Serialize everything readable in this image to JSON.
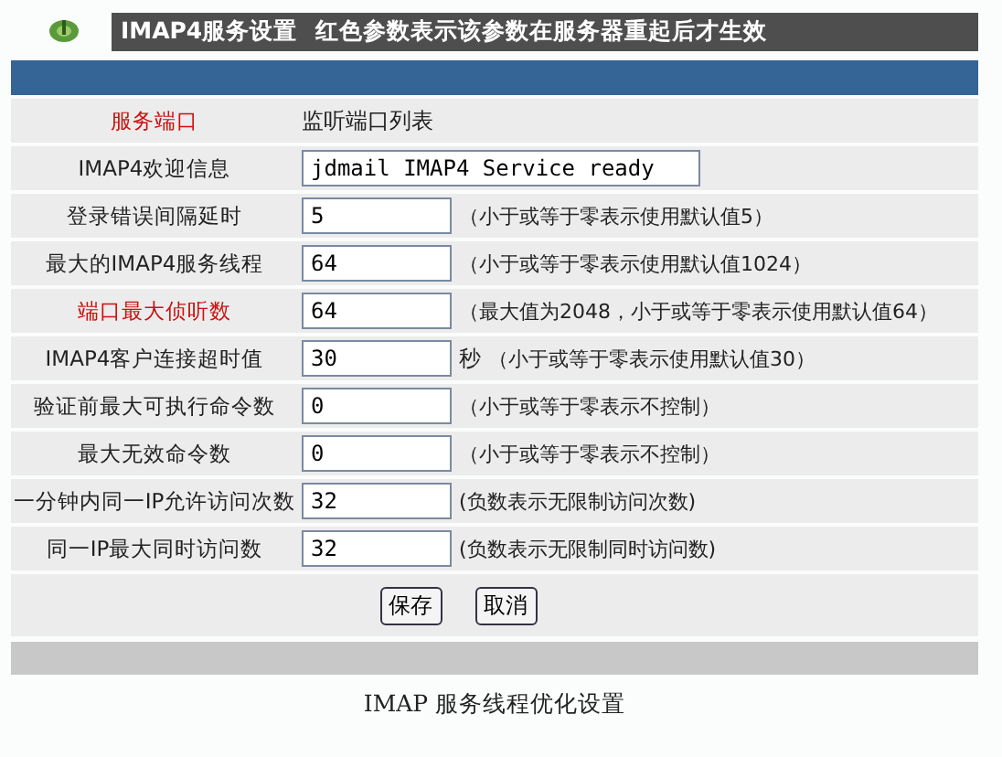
{
  "header": {
    "title": "IMAP4服务设置",
    "note": "红色参数表示该参数在服务器重起后才生效"
  },
  "rows": [
    {
      "kind": "static",
      "label": "服务端口",
      "restart": true,
      "value": "监听端口列表"
    },
    {
      "kind": "wide",
      "label": "IMAP4欢迎信息",
      "restart": false,
      "value": "jdmail IMAP4 Service ready"
    },
    {
      "kind": "input",
      "label": "登录错误间隔延时",
      "restart": false,
      "value": "5",
      "hint": "（小于或等于零表示使用默认值5）"
    },
    {
      "kind": "input",
      "label": "最大的IMAP4服务线程",
      "restart": false,
      "value": "64",
      "hint": "（小于或等于零表示使用默认值1024）"
    },
    {
      "kind": "input",
      "label": "端口最大侦听数",
      "restart": true,
      "value": "64",
      "hint": "（最大值为2048，小于或等于零表示使用默认值64）"
    },
    {
      "kind": "input",
      "label": "IMAP4客户连接超时值",
      "restart": false,
      "value": "30",
      "unit": "秒",
      "hint": "（小于或等于零表示使用默认值30）"
    },
    {
      "kind": "input",
      "label": "验证前最大可执行命令数",
      "restart": false,
      "value": "0",
      "hint": "（小于或等于零表示不控制）"
    },
    {
      "kind": "input",
      "label": "最大无效命令数",
      "restart": false,
      "value": "0",
      "hint": "（小于或等于零表示不控制）"
    },
    {
      "kind": "input",
      "label": "一分钟内同一IP允许访问次数",
      "restart": false,
      "value": "32",
      "hint": "(负数表示无限制访问次数)"
    },
    {
      "kind": "input",
      "label": "同一IP最大同时访问数",
      "restart": false,
      "value": "32",
      "hint": "(负数表示无限制同时访问数)"
    }
  ],
  "buttons": [
    "保存",
    "取消"
  ],
  "caption": "IMAP 服务线程优化设置"
}
